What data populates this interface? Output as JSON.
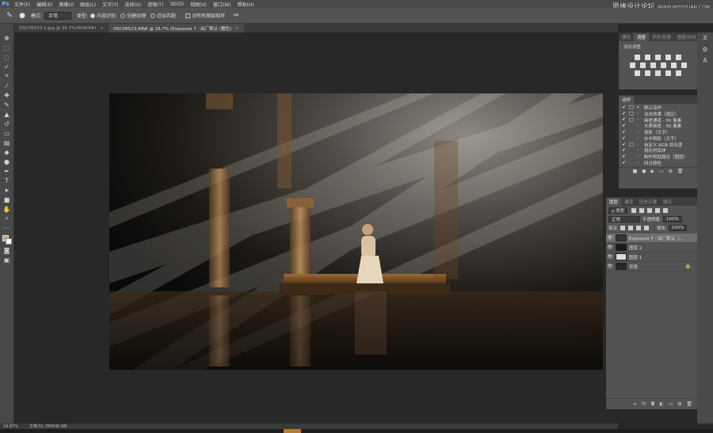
{
  "menubar": {
    "logo": "Ps",
    "items": [
      "文件(F)",
      "编辑(E)",
      "图像(I)",
      "图层(L)",
      "文字(Y)",
      "选择(S)",
      "滤镜(T)",
      "3D(D)",
      "视图(V)",
      "窗口(W)",
      "帮助(H)"
    ]
  },
  "watermark": {
    "main": "思缘设计论坛",
    "sub": "WWW.MISSYUAN.COM"
  },
  "options": {
    "mode_label": "模式:",
    "mode_value": "正常",
    "type_label": "类型:",
    "type_opt1": "内容识别",
    "type_opt2": "创建纹理",
    "type_opt3": "近似匹配",
    "sample_all_label": "对所有图层取样"
  },
  "tabs": [
    {
      "label": "DSC06523-1.jpg @ 16.7%(RGB/8#)",
      "close": "×"
    },
    {
      "label": "DSC06523.ARW @ 16.7% (Exposure 7 - 出厂默认 (橙色)",
      "close": "×"
    }
  ],
  "status": {
    "zoom": "16.67%",
    "doc": "文档:51.7M/646.9M"
  },
  "adjustments": {
    "tabs": [
      "属性",
      "调整",
      "字符/段落",
      "图层/形状"
    ],
    "title": "添加调整"
  },
  "actions": {
    "tab": "动作",
    "rows": [
      {
        "check": "✔",
        "box": true,
        "arrow": "▾",
        "name": "默认动作"
      },
      {
        "check": "✔",
        "box": true,
        "arrow": "›",
        "name": "淡出效果（选区）"
      },
      {
        "check": "✔",
        "box": true,
        "arrow": "›",
        "name": "画框通道 - 50 像素"
      },
      {
        "check": "✔",
        "box": false,
        "arrow": "›",
        "name": "木质画框 - 50 像素"
      },
      {
        "check": "✔",
        "box": false,
        "arrow": "›",
        "name": "投影（文字）"
      },
      {
        "check": "✔",
        "box": false,
        "arrow": "›",
        "name": "水中倒影（文字）"
      },
      {
        "check": "✔",
        "box": true,
        "arrow": "›",
        "name": "自定义 RGB 到灰度"
      },
      {
        "check": "✔",
        "box": false,
        "arrow": "›",
        "name": "熔化的铅块"
      },
      {
        "check": "✔",
        "box": false,
        "arrow": "›",
        "name": "制作剪贴路径（图层）"
      },
      {
        "check": "✔",
        "box": false,
        "arrow": "›",
        "name": "四分颜色"
      }
    ]
  },
  "layers": {
    "tabs": [
      "图层",
      "通道",
      "历史记录",
      "路径"
    ],
    "filter_label": "ρ 类型",
    "blend_mode": "正常",
    "opacity_label": "不透明度:",
    "opacity_value": "100%",
    "lock_label": "锁定:",
    "fill_label": "填充:",
    "fill_value": "100%",
    "items": [
      {
        "name": "Exposure 7 - 出厂默认（...",
        "thumb": "#3a342c",
        "active": true,
        "lock": ""
      },
      {
        "name": "图层 2",
        "thumb": "#1a1a1a",
        "active": false,
        "lock": ""
      },
      {
        "name": "图层 1",
        "thumb": "#dcdcdc",
        "active": false,
        "lock": ""
      },
      {
        "name": "背景",
        "thumb": "#2b2620",
        "active": false,
        "lock": "🔒"
      }
    ]
  }
}
